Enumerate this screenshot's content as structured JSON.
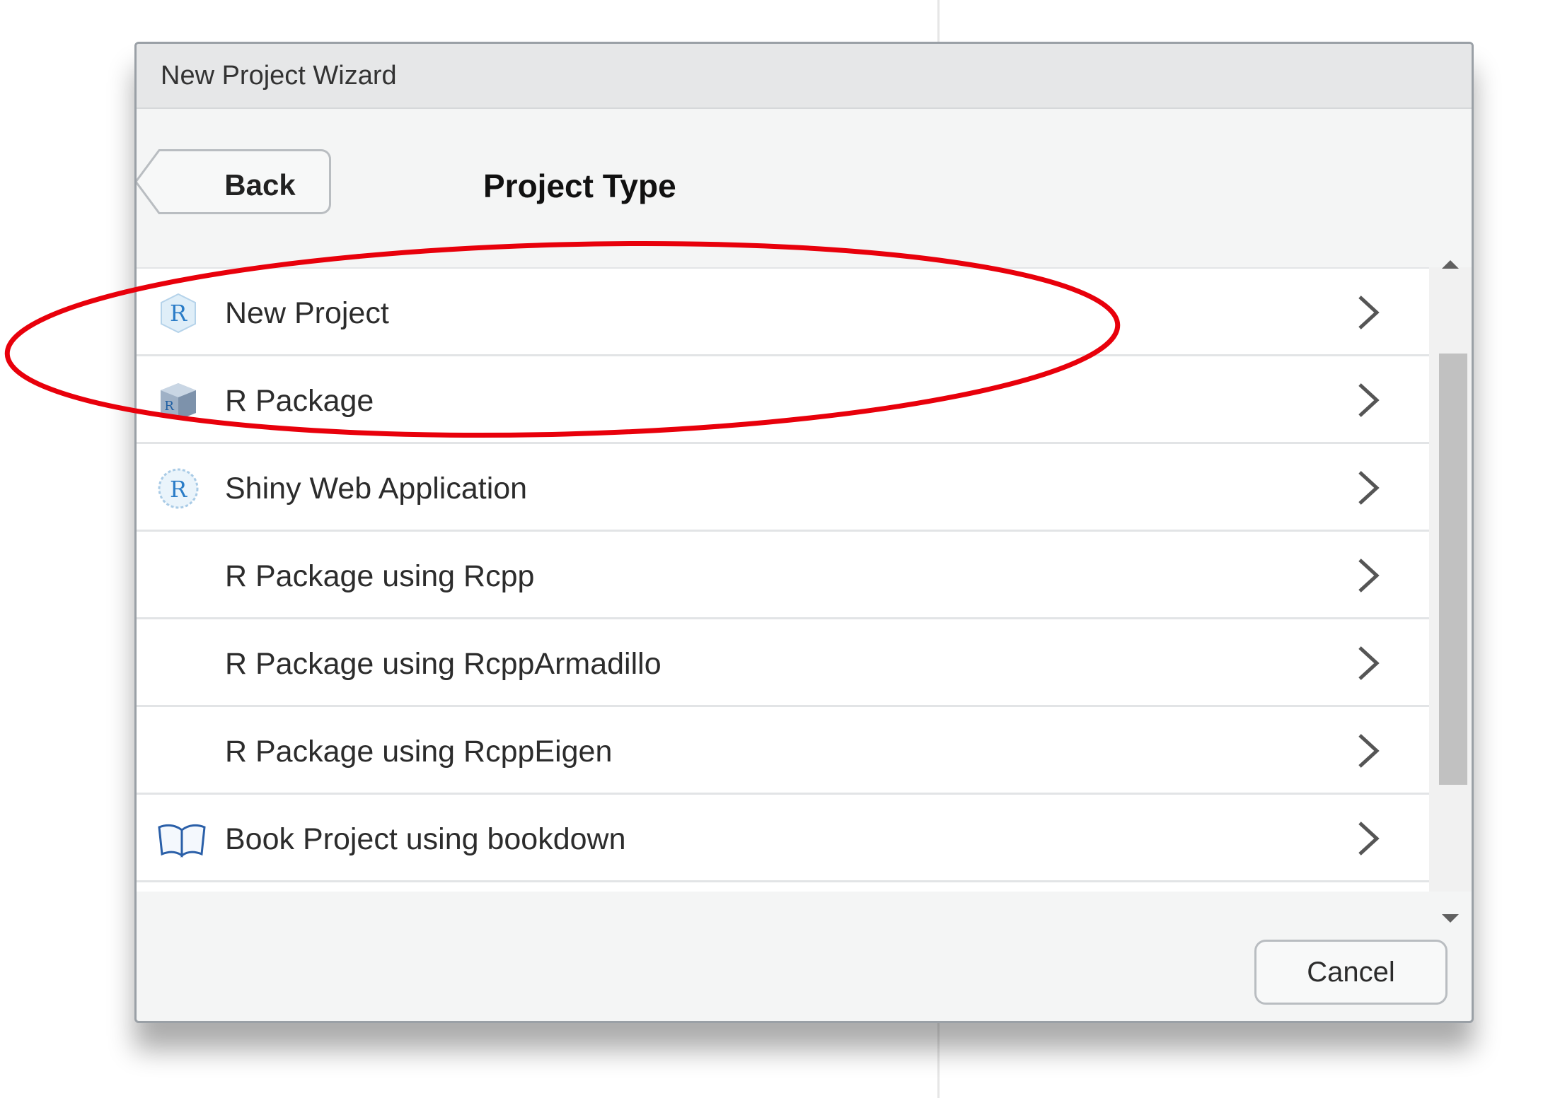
{
  "window": {
    "title": "New Project Wizard"
  },
  "header": {
    "back_label": "Back",
    "heading": "Project Type"
  },
  "project_types": [
    {
      "label": "New Project",
      "icon": "r-project-icon"
    },
    {
      "label": "R Package",
      "icon": "r-package-icon"
    },
    {
      "label": "Shiny Web Application",
      "icon": "shiny-icon"
    },
    {
      "label": "R Package using Rcpp",
      "icon": ""
    },
    {
      "label": "R Package using RcppArmadillo",
      "icon": ""
    },
    {
      "label": "R Package using RcppEigen",
      "icon": ""
    },
    {
      "label": "Book Project using bookdown",
      "icon": "book-icon"
    }
  ],
  "footer": {
    "cancel_label": "Cancel"
  },
  "annotation": {
    "highlight_color": "#e8000b",
    "highlighted_item": "New Project"
  }
}
